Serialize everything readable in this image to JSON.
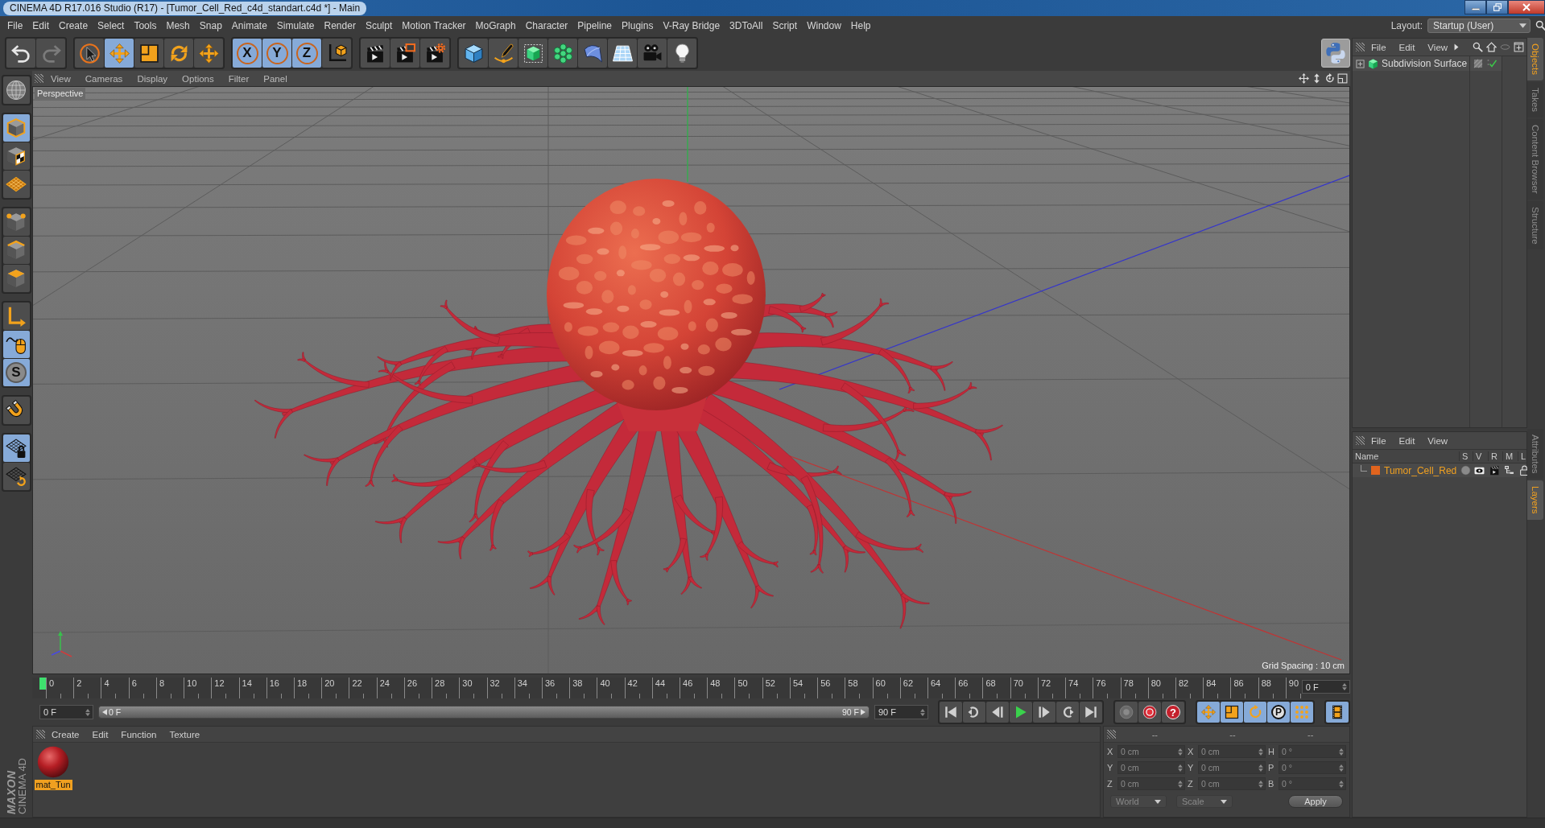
{
  "window": {
    "title": "CINEMA 4D R17.016 Studio (R17) - [Tumor_Cell_Red_c4d_standart.c4d *] - Main"
  },
  "menu_bar": {
    "items": [
      "File",
      "Edit",
      "Create",
      "Select",
      "Tools",
      "Mesh",
      "Snap",
      "Animate",
      "Simulate",
      "Render",
      "Sculpt",
      "Motion Tracker",
      "MoGraph",
      "Character",
      "Pipeline",
      "Plugins",
      "V-Ray Bridge",
      "3DToAll",
      "Script",
      "Window",
      "Help"
    ],
    "layout_label": "Layout:",
    "layout_value": "Startup (User)"
  },
  "toolbar": {
    "groups": [
      {
        "buttons": [
          {
            "kind": "undo",
            "disabled": false
          },
          {
            "kind": "redo",
            "disabled": true
          }
        ]
      },
      {
        "buttons": [
          {
            "kind": "live-select",
            "selected": false
          },
          {
            "kind": "move",
            "selected": true
          },
          {
            "kind": "scale",
            "selected": false
          },
          {
            "kind": "rotate",
            "selected": false
          },
          {
            "kind": "last-tool",
            "selected": false
          }
        ]
      },
      {
        "buttons": [
          {
            "kind": "axis-lock",
            "label": "X",
            "selected": true
          },
          {
            "kind": "axis-lock",
            "label": "Y",
            "selected": true
          },
          {
            "kind": "axis-lock",
            "label": "Z",
            "selected": true
          },
          {
            "kind": "coord-system",
            "selected": false
          }
        ]
      },
      {
        "buttons": [
          {
            "kind": "render-view",
            "selected": false
          },
          {
            "kind": "render-picture",
            "selected": false
          },
          {
            "kind": "render-settings",
            "selected": false
          }
        ]
      },
      {
        "buttons": [
          {
            "kind": "cube",
            "selected": false
          },
          {
            "kind": "pen",
            "selected": false
          },
          {
            "kind": "subdivision",
            "selected": false
          },
          {
            "kind": "cloner",
            "selected": false
          },
          {
            "kind": "deformer",
            "selected": false
          },
          {
            "kind": "floor",
            "selected": false
          },
          {
            "kind": "camera",
            "selected": false
          },
          {
            "kind": "light",
            "selected": false
          }
        ]
      }
    ]
  },
  "left_toolbar": {
    "groups": [
      {
        "buttons": [
          {
            "kind": "make-editable",
            "selected": false
          }
        ]
      },
      {
        "buttons": [
          {
            "kind": "model",
            "selected": true
          },
          {
            "kind": "texture",
            "selected": false
          },
          {
            "kind": "workplane",
            "selected": false
          }
        ]
      },
      {
        "buttons": [
          {
            "kind": "points",
            "selected": false
          },
          {
            "kind": "edges",
            "selected": false
          },
          {
            "kind": "polygons",
            "selected": false
          }
        ]
      },
      {
        "buttons": [
          {
            "kind": "axis",
            "selected": false
          },
          {
            "kind": "tweak",
            "selected": true
          },
          {
            "kind": "solo",
            "label": "S",
            "selected": true
          }
        ]
      },
      {
        "buttons": [
          {
            "kind": "snap",
            "selected": false
          }
        ]
      },
      {
        "buttons": [
          {
            "kind": "workplane-lock",
            "selected": true
          },
          {
            "kind": "workplane-grid",
            "selected": false
          }
        ]
      }
    ]
  },
  "viewport": {
    "menus": [
      "View",
      "Cameras",
      "Display",
      "Options",
      "Filter",
      "Panel"
    ],
    "camera": "Perspective",
    "grid_spacing": "Grid Spacing : 10 cm"
  },
  "timeline": {
    "ticks": [
      {
        "label": "0",
        "selected": true
      },
      {
        "label": "2",
        "selected": false
      },
      {
        "label": "4",
        "selected": false
      },
      {
        "label": "6",
        "selected": false
      },
      {
        "label": "8",
        "selected": false
      },
      {
        "label": "10",
        "selected": false
      },
      {
        "label": "12",
        "selected": false
      },
      {
        "label": "14",
        "selected": false
      },
      {
        "label": "16",
        "selected": false
      },
      {
        "label": "18",
        "selected": false
      },
      {
        "label": "20",
        "selected": false
      },
      {
        "label": "22",
        "selected": false
      },
      {
        "label": "24",
        "selected": false
      },
      {
        "label": "26",
        "selected": false
      },
      {
        "label": "28",
        "selected": false
      },
      {
        "label": "30",
        "selected": false
      },
      {
        "label": "32",
        "selected": false
      },
      {
        "label": "34",
        "selected": false
      },
      {
        "label": "36",
        "selected": false
      },
      {
        "label": "38",
        "selected": false
      },
      {
        "label": "40",
        "selected": false
      },
      {
        "label": "42",
        "selected": false
      },
      {
        "label": "44",
        "selected": false
      },
      {
        "label": "46",
        "selected": false
      },
      {
        "label": "48",
        "selected": false
      },
      {
        "label": "50",
        "selected": false
      },
      {
        "label": "52",
        "selected": false
      },
      {
        "label": "54",
        "selected": false
      },
      {
        "label": "56",
        "selected": false
      },
      {
        "label": "58",
        "selected": false
      },
      {
        "label": "60",
        "selected": false
      },
      {
        "label": "62",
        "selected": false
      },
      {
        "label": "64",
        "selected": false
      },
      {
        "label": "66",
        "selected": false
      },
      {
        "label": "68",
        "selected": false
      },
      {
        "label": "70",
        "selected": false
      },
      {
        "label": "72",
        "selected": false
      },
      {
        "label": "74",
        "selected": false
      },
      {
        "label": "76",
        "selected": false
      },
      {
        "label": "78",
        "selected": false
      },
      {
        "label": "80",
        "selected": false
      },
      {
        "label": "82",
        "selected": false
      },
      {
        "label": "84",
        "selected": false
      },
      {
        "label": "86",
        "selected": false
      },
      {
        "label": "88",
        "selected": false
      },
      {
        "label": "90",
        "selected": false
      }
    ],
    "current_frame": "0 F",
    "start_frame": "0 F",
    "range": {
      "start": "0 F",
      "end": "90 F",
      "level": 1
    },
    "end_frame": "90 F",
    "playback": [
      {
        "kind": "first"
      },
      {
        "kind": "prev-key"
      },
      {
        "kind": "prev-frame"
      },
      {
        "kind": "play"
      },
      {
        "kind": "next-frame"
      },
      {
        "kind": "next-key"
      },
      {
        "kind": "last"
      }
    ],
    "record": [
      {
        "kind": "record"
      },
      {
        "kind": "autokey"
      },
      {
        "kind": "key-help",
        "label": "?"
      }
    ],
    "keys": [
      {
        "kind": "position",
        "selected": true
      },
      {
        "kind": "scale",
        "selected": true
      },
      {
        "kind": "rotation",
        "selected": true
      },
      {
        "kind": "parameter",
        "label": "P",
        "selected": true
      },
      {
        "kind": "point-level",
        "selected": true
      }
    ]
  },
  "material_manager": {
    "menus": [
      "Create",
      "Edit",
      "Function",
      "Texture"
    ],
    "materials": [
      {
        "name": "mat_Tun",
        "selected": true
      }
    ]
  },
  "coordinates": {
    "headers": [
      "--",
      "--",
      "--"
    ],
    "rows": [
      {
        "fields": [
          {
            "axis": "X",
            "value": "0 cm"
          },
          {
            "axis": "X",
            "value": "0 cm"
          },
          {
            "axis": "H",
            "value": "0 °"
          }
        ]
      },
      {
        "fields": [
          {
            "axis": "Y",
            "value": "0 cm"
          },
          {
            "axis": "Y",
            "value": "0 cm"
          },
          {
            "axis": "P",
            "value": "0 °"
          }
        ]
      },
      {
        "fields": [
          {
            "axis": "Z",
            "value": "0 cm"
          },
          {
            "axis": "Z",
            "value": "0 cm"
          },
          {
            "axis": "B",
            "value": "0 °"
          }
        ]
      }
    ],
    "dropdowns": [
      "World",
      "Scale"
    ],
    "apply": "Apply"
  },
  "object_manager": {
    "menus": [
      "File",
      "Edit",
      "View"
    ],
    "objects": [
      {
        "name": "Subdivision Surface",
        "expanded": false,
        "enabled": true
      }
    ]
  },
  "layer_manager": {
    "menus": [
      "File",
      "Edit",
      "View"
    ],
    "columns": [
      "Name",
      "S",
      "V",
      "R",
      "M",
      "L"
    ],
    "layers": [
      {
        "name": "Tumor_Cell_Red",
        "color": "#e0641e",
        "selected": true
      }
    ]
  },
  "side_tabs": {
    "upper": [
      {
        "label": "Objects",
        "selected": true
      },
      {
        "label": "Takes",
        "selected": false
      },
      {
        "label": "Content Browser",
        "selected": false
      },
      {
        "label": "Structure",
        "selected": false
      }
    ],
    "lower": [
      {
        "label": "Attributes",
        "selected": false
      },
      {
        "label": "Layers",
        "selected": true
      }
    ]
  },
  "logo": {
    "brand": "MAXON",
    "product": "CINEMA 4D"
  }
}
